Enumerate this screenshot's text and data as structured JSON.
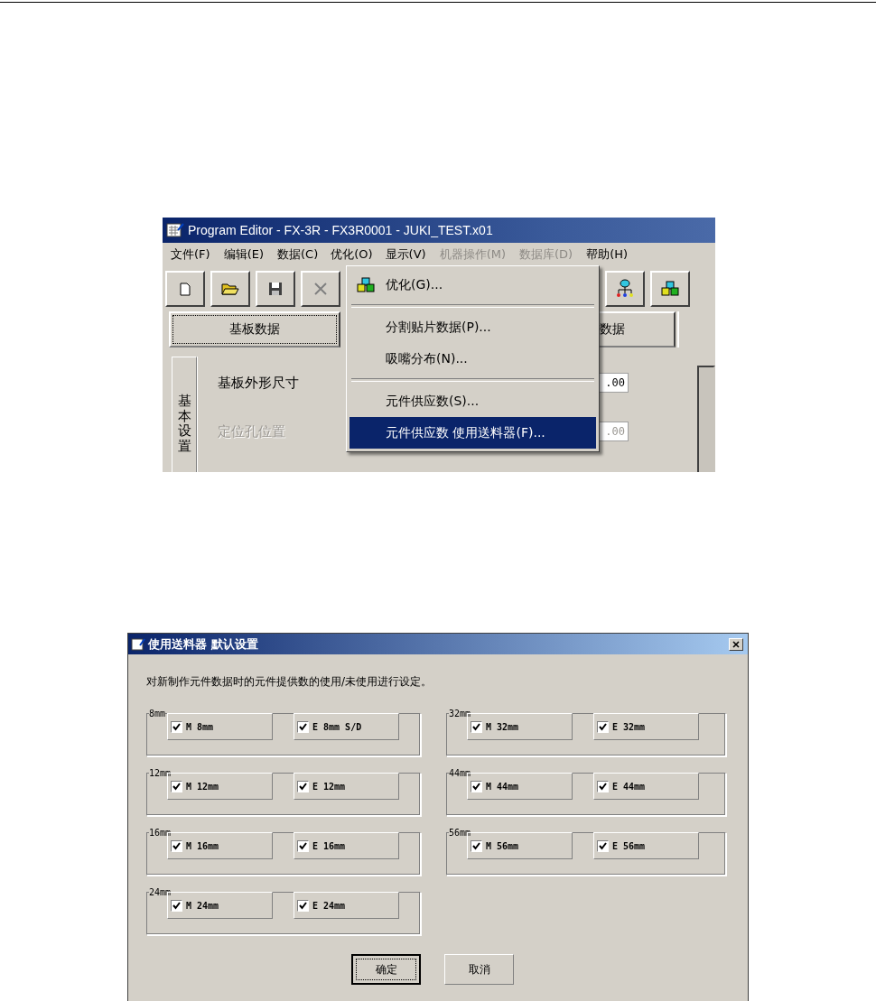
{
  "program_editor": {
    "title": "Program Editor - FX-3R - FX3R0001 - JUKI_TEST.x01",
    "menu": [
      {
        "label": "文件(F)",
        "selected": false,
        "disabled": false
      },
      {
        "label": "编辑(E)",
        "selected": false,
        "disabled": false
      },
      {
        "label": "数据(C)",
        "selected": false,
        "disabled": false
      },
      {
        "label": "优化(O)",
        "selected": true,
        "disabled": false
      },
      {
        "label": "显示(V)",
        "selected": false,
        "disabled": false
      },
      {
        "label": "机器操作(M)",
        "selected": false,
        "disabled": true
      },
      {
        "label": "数据库(D)",
        "selected": false,
        "disabled": true
      },
      {
        "label": "帮助(H)",
        "selected": false,
        "disabled": false
      }
    ],
    "tabs": [
      {
        "label": "基板数据",
        "selected": true
      },
      {
        "label": "数据",
        "selected": false
      }
    ],
    "side_tab": "基本设置",
    "fields": [
      {
        "label": "基板外形尺寸",
        "value": ".00",
        "disabled": false
      },
      {
        "label": "定位孔位置",
        "value": ".00",
        "disabled": true
      }
    ],
    "dropdown": [
      {
        "kind": "icon_item",
        "label": "优化(G)...",
        "selected": false
      },
      {
        "kind": "separator"
      },
      {
        "kind": "item",
        "label": "分割贴片数据(P)...",
        "selected": false
      },
      {
        "kind": "item",
        "label": "吸嘴分布(N)...",
        "selected": false
      },
      {
        "kind": "separator"
      },
      {
        "kind": "item",
        "label": "元件供应数(S)...",
        "selected": false
      },
      {
        "kind": "item",
        "label": "元件供应数 使用送料器(F)...",
        "selected": true
      }
    ]
  },
  "feeder_dialog": {
    "title": "使用送料器 默认设置",
    "instruction": "对新制作元件数据时的元件提供数的使用/未使用进行设定。",
    "columns": [
      [
        {
          "title": "8mm",
          "options": [
            {
              "label": "M 8mm",
              "checked": true
            },
            {
              "label": "E 8mm S/D",
              "checked": true
            }
          ]
        },
        {
          "title": "12mm",
          "options": [
            {
              "label": "M 12mm",
              "checked": true
            },
            {
              "label": "E 12mm",
              "checked": true
            }
          ]
        },
        {
          "title": "16mm",
          "options": [
            {
              "label": "M 16mm",
              "checked": true
            },
            {
              "label": "E 16mm",
              "checked": true
            }
          ]
        },
        {
          "title": "24mm",
          "options": [
            {
              "label": "M 24mm",
              "checked": true
            },
            {
              "label": "E 24mm",
              "checked": true
            }
          ]
        }
      ],
      [
        {
          "title": "32mm",
          "options": [
            {
              "label": "M 32mm",
              "checked": true
            },
            {
              "label": "E 32mm",
              "checked": true
            }
          ]
        },
        {
          "title": "44mm",
          "options": [
            {
              "label": "M 44mm",
              "checked": true
            },
            {
              "label": "E 44mm",
              "checked": true
            }
          ]
        },
        {
          "title": "56mm",
          "options": [
            {
              "label": "M 56mm",
              "checked": true
            },
            {
              "label": "E 56mm",
              "checked": true
            }
          ]
        }
      ]
    ],
    "buttons": [
      {
        "label": "确定",
        "default": true
      },
      {
        "label": "取消",
        "default": false
      }
    ]
  }
}
